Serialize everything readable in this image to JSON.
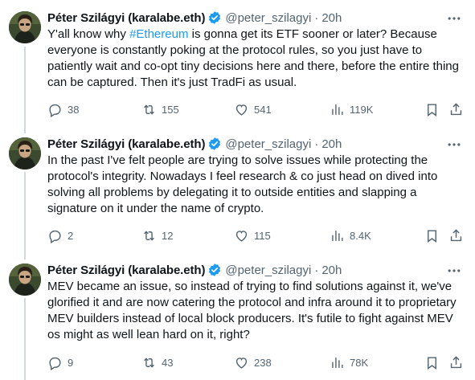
{
  "tweets": [
    {
      "author_name": "Péter Szilágyi (karalabe.eth)",
      "handle": "@peter_szilagyi",
      "separator": "·",
      "time": "20h",
      "text_before": "Y'all know why ",
      "hashtag": "#Ethereum",
      "text_after": " is gonna get its ETF sooner or later? Because everyone is constantly poking at the protocol rules, so you just have to patiently wait and co-opt tiny decisions here and there, before the entire thing can be captured. Then it's just TradFi as usual.",
      "replies": "38",
      "reposts": "155",
      "likes": "541",
      "views": "119K"
    },
    {
      "author_name": "Péter Szilágyi (karalabe.eth)",
      "handle": "@peter_szilagyi",
      "separator": "·",
      "time": "20h",
      "text_before": "In the past I've felt people are trying to solve issues while protecting the protocol's integrity. Nowadays I feel research & co just head on dived into solving all problems by delegating it to outside entities and slapping a signature on it under the name of crypto.",
      "hashtag": "",
      "text_after": "",
      "replies": "2",
      "reposts": "12",
      "likes": "115",
      "views": "8.4K"
    },
    {
      "author_name": "Péter Szilágyi (karalabe.eth)",
      "handle": "@peter_szilagyi",
      "separator": "·",
      "time": "20h",
      "text_before": "MEV became an issue, so instead of trying to find solutions against it, we've glorified it and are now catering the protocol and infra around it to proprietary MEV builders instead of local block producers. It's futile to fight against MEV os might as well lean hard on it, right?",
      "hashtag": "",
      "text_after": "",
      "replies": "9",
      "reposts": "43",
      "likes": "238",
      "views": "78K"
    }
  ],
  "colors": {
    "text": "#0f1419",
    "muted": "#536471",
    "link": "#1d9bf0",
    "verified": "#1d9bf0",
    "thread_line": "#cfd9de"
  },
  "icons": [
    "reply-icon",
    "repost-icon",
    "like-icon",
    "views-icon",
    "bookmark-icon",
    "share-icon",
    "more-icon",
    "verified-badge-icon"
  ]
}
